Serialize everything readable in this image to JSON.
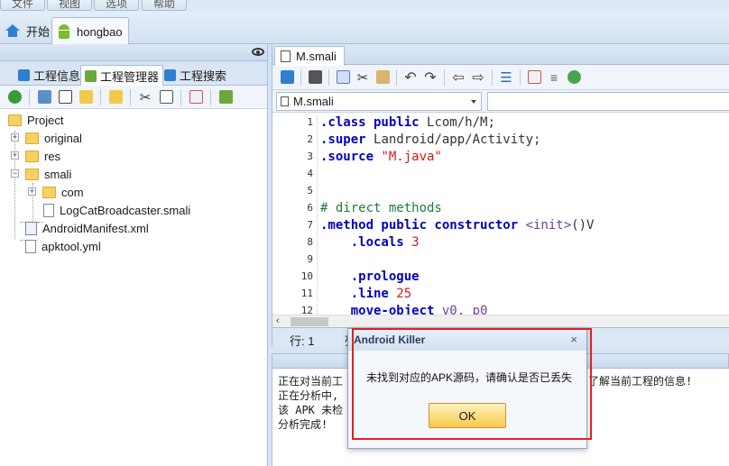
{
  "menu": [
    "文件",
    "视图",
    "选项",
    "帮助"
  ],
  "doc_tabs": [
    {
      "label": "开始",
      "icon": "home-icon"
    },
    {
      "label": "hongbao",
      "icon": "android-icon",
      "active": true
    }
  ],
  "left_panel": {
    "tabs": [
      {
        "label": "工程信息",
        "color": "#2f7fd0"
      },
      {
        "label": "工程管理器",
        "color": "#6aa83a",
        "active": true
      },
      {
        "label": "工程搜索",
        "color": "#2f7fd0"
      }
    ],
    "tree": {
      "project": "Project",
      "original": "original",
      "res": "res",
      "smali": "smali",
      "com": "com",
      "logcat": "LogCatBroadcaster.smali",
      "manifest": "AndroidManifest.xml",
      "apktool": "apktool.yml"
    }
  },
  "editor": {
    "tab": "M.smali",
    "combo_file": "M.smali",
    "line_numbers": [
      "1",
      "2",
      "3",
      "4",
      "5",
      "6",
      "7",
      "8",
      "9",
      "10",
      "11",
      "12"
    ],
    "code": {
      "l1a": ".class public ",
      "l1b": "Lcom/h/M;",
      "l2a": ".super ",
      "l2b": "Landroid/app/Activity;",
      "l3a": ".source ",
      "l3b": "\"M.java\"",
      "l6": "# direct methods",
      "l7a": ".method public constructor ",
      "l7b": "<init>",
      "l7c": "()V",
      "l8a": "    .locals ",
      "l8b": "3",
      "l10": "    .prologue",
      "l11a": "    .line ",
      "l11b": "25",
      "l12a": "    move-object ",
      "l12b": "v0, p0"
    },
    "status_row": "行: 1",
    "status_col": "列"
  },
  "output": {
    "lines": [
      "正在对当前工",
      "正在分析中,",
      "该 APK 未检",
      "分析完成!"
    ],
    "tail": "了解当前工程的信息!"
  },
  "dialog": {
    "title": "Android Killer",
    "message": "未找到对应的APK源码，请确认是否已丢失",
    "ok": "OK",
    "close": "×"
  },
  "colors": {
    "keyword": "#0000c0",
    "string": "#d11a1a",
    "comment": "#1f7a3a",
    "highlight_box": "#e22020"
  }
}
